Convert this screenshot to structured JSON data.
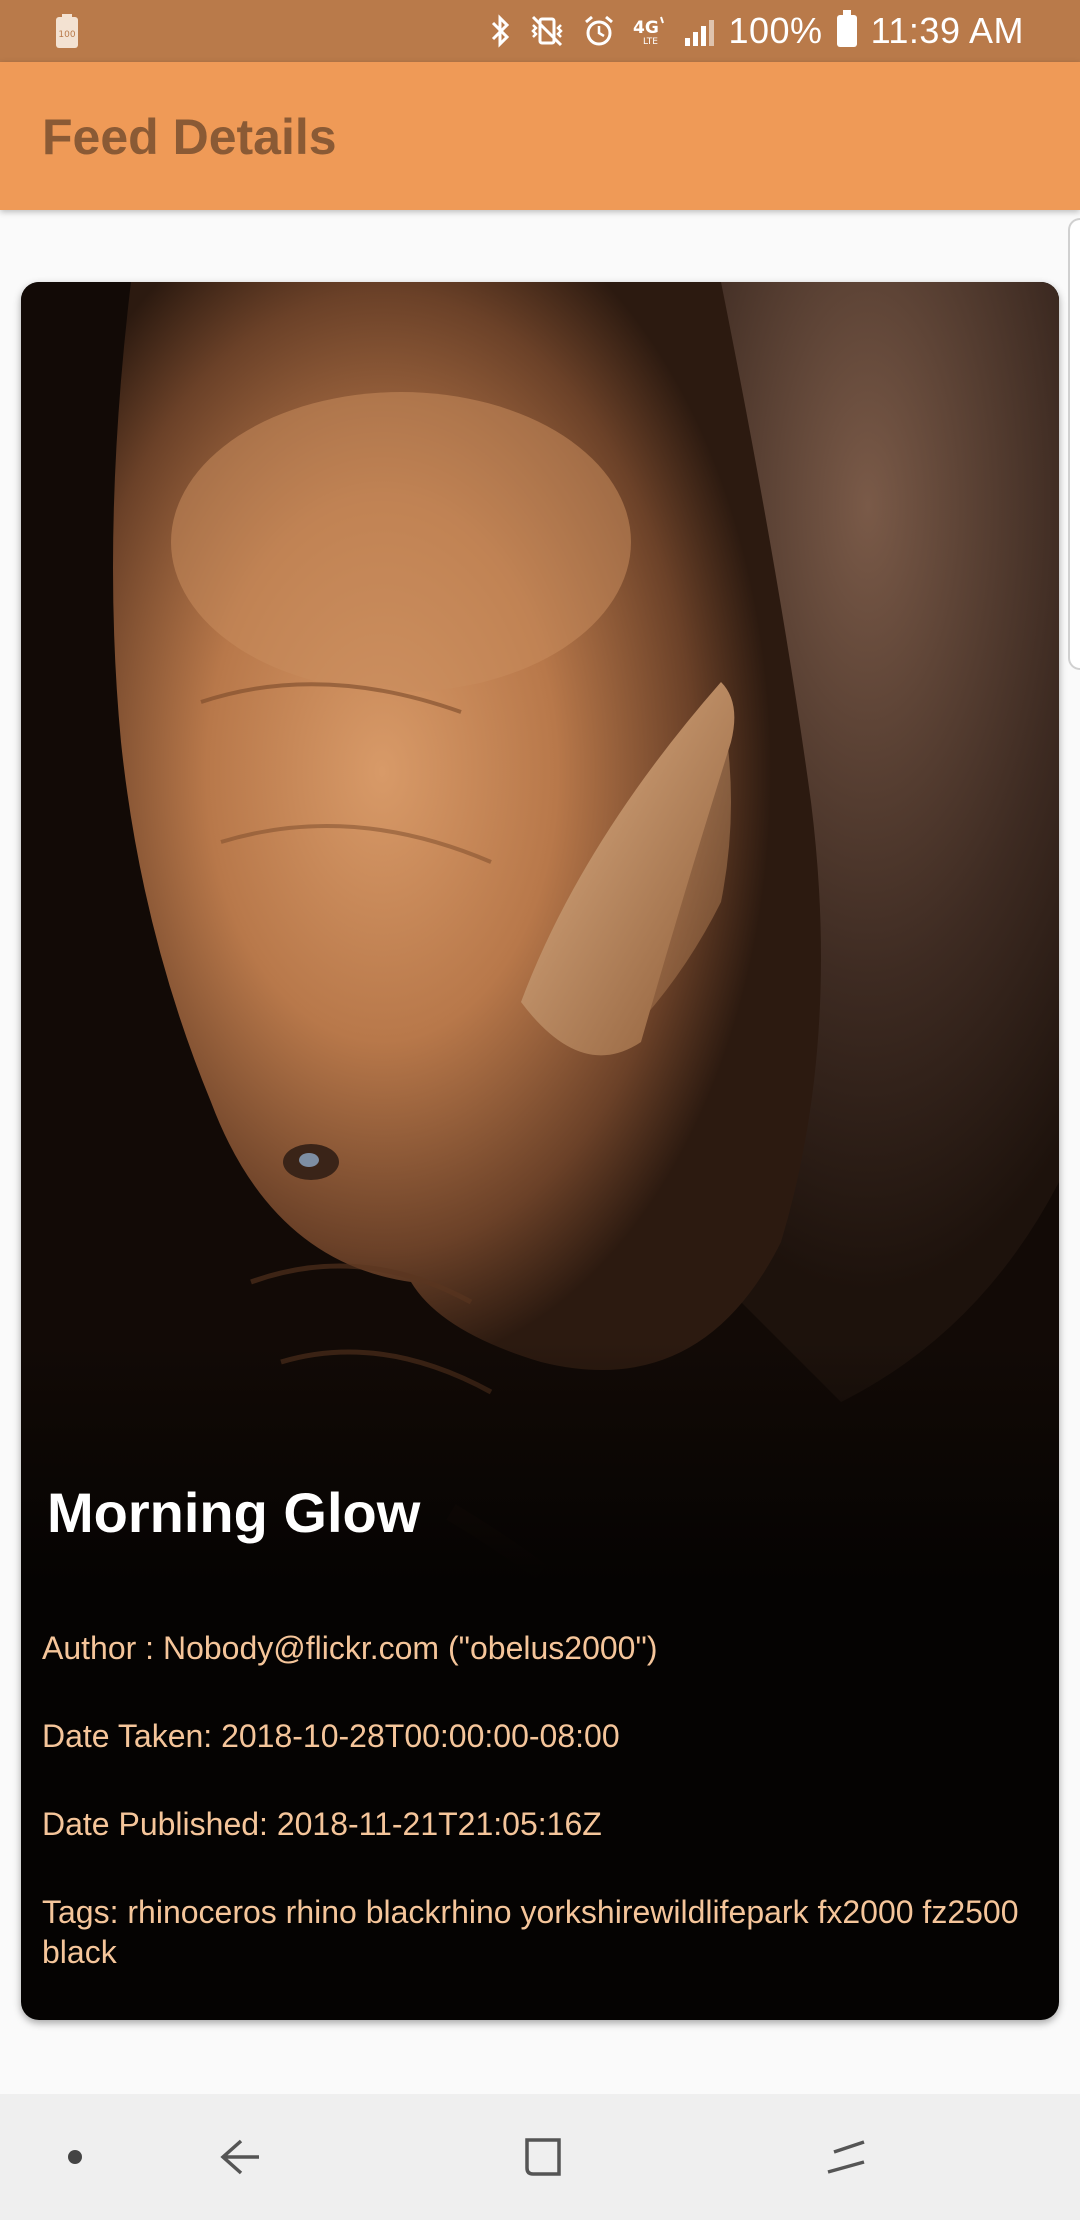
{
  "status_bar": {
    "battery_saver_text": "100",
    "battery_percent": "100%",
    "time": "11:39 AM",
    "icons": [
      "battery-saver-icon",
      "bluetooth-icon",
      "vibrate-icon",
      "alarm-icon",
      "lte-icon",
      "signal-icon",
      "battery-icon"
    ]
  },
  "app_bar": {
    "title": "Feed Details"
  },
  "card": {
    "title": "Morning Glow",
    "author": "Author : Nobody@flickr.com (\"obelus2000\")",
    "date_taken": "Date Taken: 2018-10-28T00:00:00-08:00",
    "date_published": "Date Published: 2018-11-21T21:05:16Z",
    "tags": "Tags: rhinoceros rhino blackrhino yorkshirewildlifepark fx2000 fz2500 black"
  },
  "nav_bar": {
    "icons": [
      "dot-icon",
      "back-icon",
      "recents-icon",
      "switch-apps-icon"
    ]
  },
  "colors": {
    "status_bar": "#b97a4a",
    "app_bar": "#ef9a57",
    "title_text": "#8a5a35",
    "info_text": "#f5c59a"
  }
}
